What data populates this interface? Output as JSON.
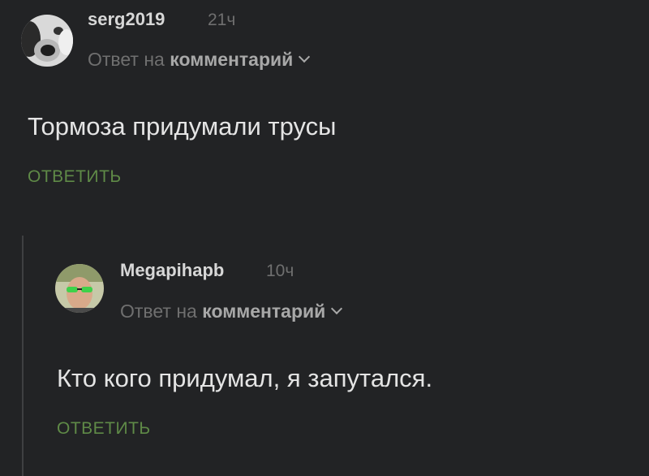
{
  "comments": [
    {
      "author": "serg2019",
      "time": "21ч",
      "reply_prefix": "Ответ на",
      "reply_target": "комментарий",
      "text": "Тормоза придумали трусы",
      "reply_label": "ОТВЕТИТЬ",
      "avatar_icon": "dog-avatar-icon"
    },
    {
      "author": "Megapihapb",
      "time": "10ч",
      "reply_prefix": "Ответ на",
      "reply_target": "комментарий",
      "text": "Кто кого придумал, я запутался.",
      "reply_label": "ОТВЕТИТЬ",
      "avatar_icon": "man-sunglasses-avatar-icon"
    }
  ],
  "colors": {
    "background": "#222325",
    "accent_green": "#5f8a47",
    "text_primary": "#e4e4e4",
    "text_muted": "#6f6f6f"
  }
}
